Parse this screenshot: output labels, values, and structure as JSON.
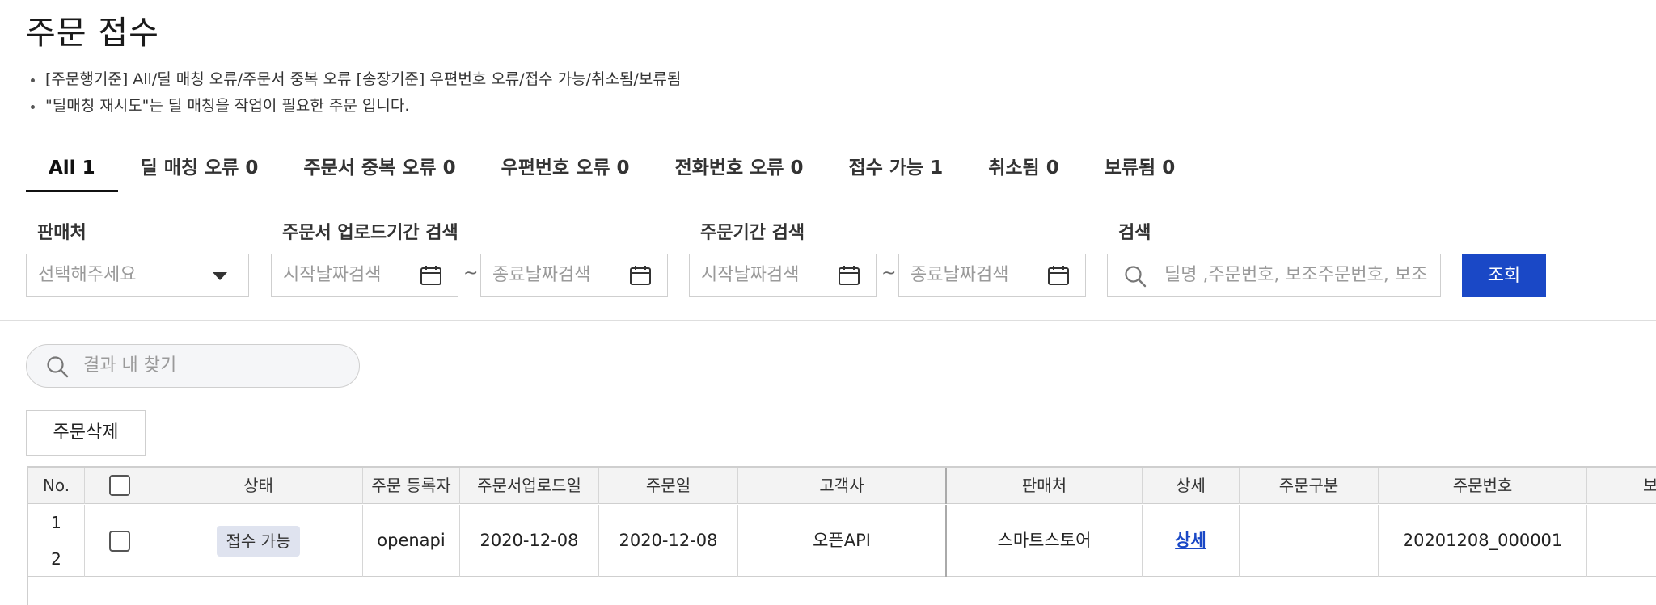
{
  "page": {
    "title": "주문 접수",
    "notes": [
      "[주문행기준] All/딜 매칭 오류/주문서 중복 오류 [송장기준] 우편번호 오류/접수 가능/취소됨/보류됨",
      "\"딜매칭 재시도\"는 딜 매칭을 작업이 필요한 주문 입니다."
    ]
  },
  "tabs": [
    {
      "label": "All 1",
      "active": true
    },
    {
      "label": "딜 매칭 오류 0"
    },
    {
      "label": "주문서 중복 오류 0"
    },
    {
      "label": "우편번호 오류 0"
    },
    {
      "label": "전화번호 오류 0"
    },
    {
      "label": "접수 가능 1"
    },
    {
      "label": "취소됨 0"
    },
    {
      "label": "보류됨 0"
    }
  ],
  "filters": {
    "seller_label": "판매처",
    "seller_placeholder": "선택해주세요",
    "upload_period_label": "주문서 업로드기간 검색",
    "order_period_label": "주문기간 검색",
    "start_date_placeholder": "시작날짜검색",
    "end_date_placeholder": "종료날짜검색",
    "range_separator": "~",
    "search_label": "검색",
    "search_placeholder": "딜명 ,주문번호, 보조주문번호, 보조",
    "search_button": "조회"
  },
  "inner_search_placeholder": "결과 내 찾기",
  "delete_button": "주문삭제",
  "table": {
    "headers": [
      "No.",
      "",
      "상태",
      "주문 등록자",
      "주문서업로드일",
      "주문일",
      "고객사",
      "판매처",
      "상세",
      "주문구분",
      "주문번호",
      "보조"
    ],
    "rows": [
      {
        "no": [
          "1",
          "2"
        ],
        "status": "접수 가능",
        "registrant": "openapi",
        "upload_date": "2020-12-08",
        "order_date": "2020-12-08",
        "client": "오픈API",
        "seller": "스마트스토어",
        "detail": "상세",
        "order_type": "",
        "order_no": "20201208_000001"
      }
    ]
  },
  "colors": {
    "primary": "#1a48c6",
    "badge_bg": "#dfe3ef",
    "header_bg": "#f3f3f3"
  }
}
